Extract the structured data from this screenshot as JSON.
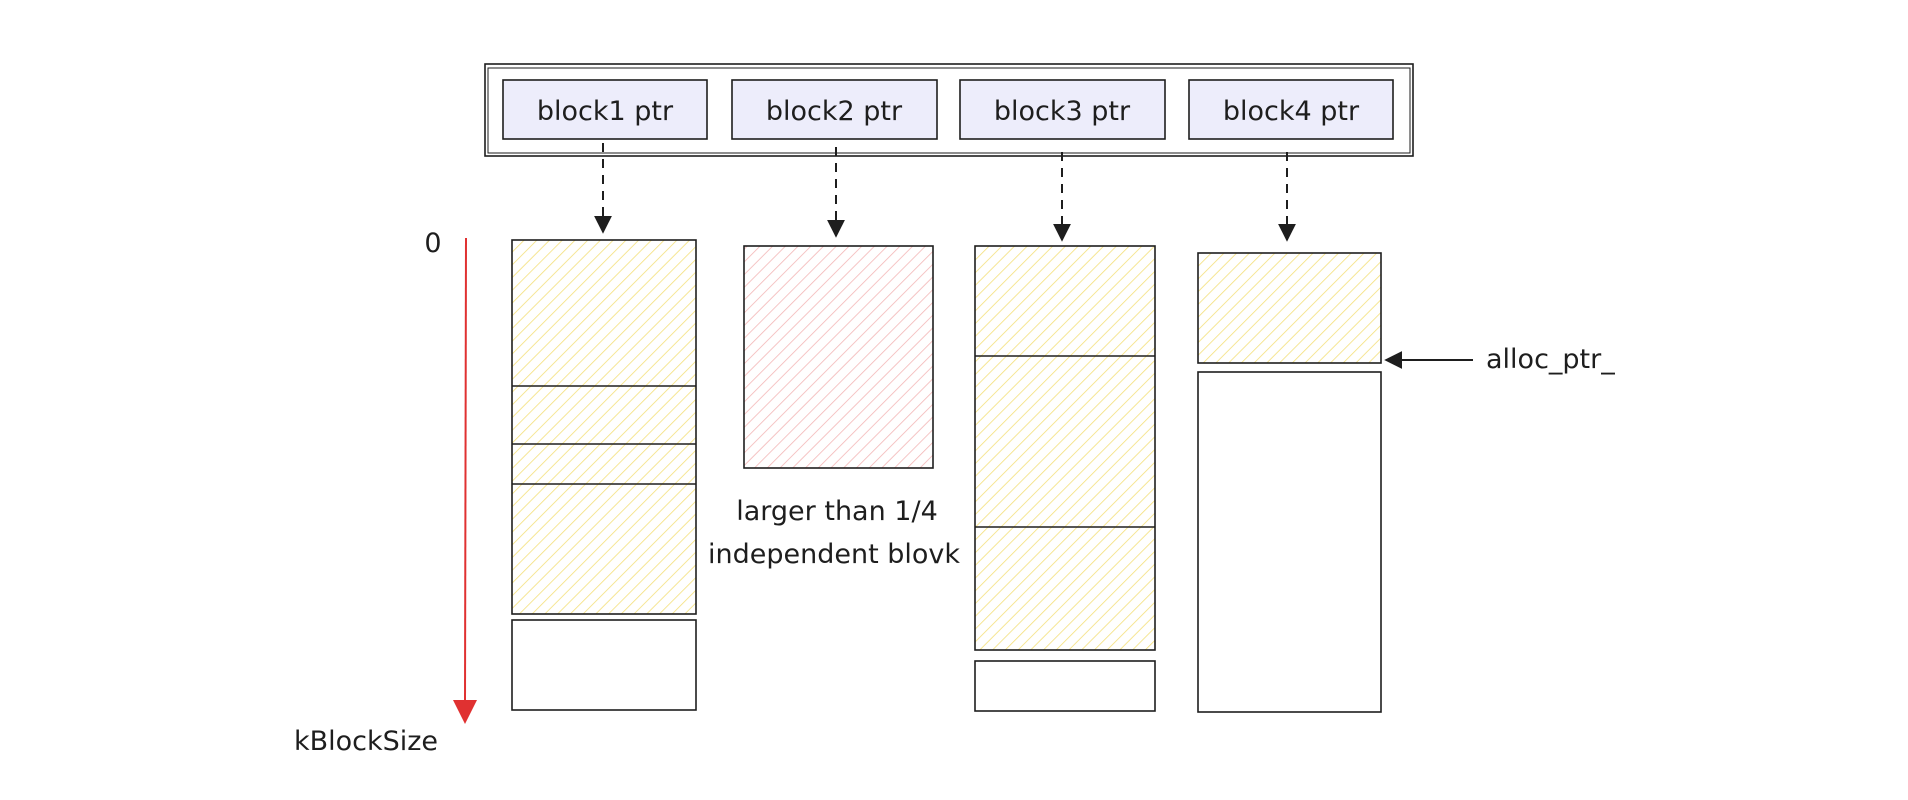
{
  "pointer_array": {
    "labels": [
      "block1 ptr",
      "block2 ptr",
      "block3 ptr",
      "block4 ptr"
    ]
  },
  "axis": {
    "top_label": "0",
    "bottom_label": "kBlockSize",
    "color": "#e03131"
  },
  "annotations": {
    "large_block_line1": "larger than 1/4",
    "large_block_line2": "independent blovk",
    "alloc_pointer": "alloc_ptr_"
  },
  "colors": {
    "stroke": "#1e1e1e",
    "pointer_fill": "#ededfb",
    "used_hatch": "#f4e07a",
    "large_hatch": "#f3b6b6",
    "free_fill": "#ffffff"
  }
}
